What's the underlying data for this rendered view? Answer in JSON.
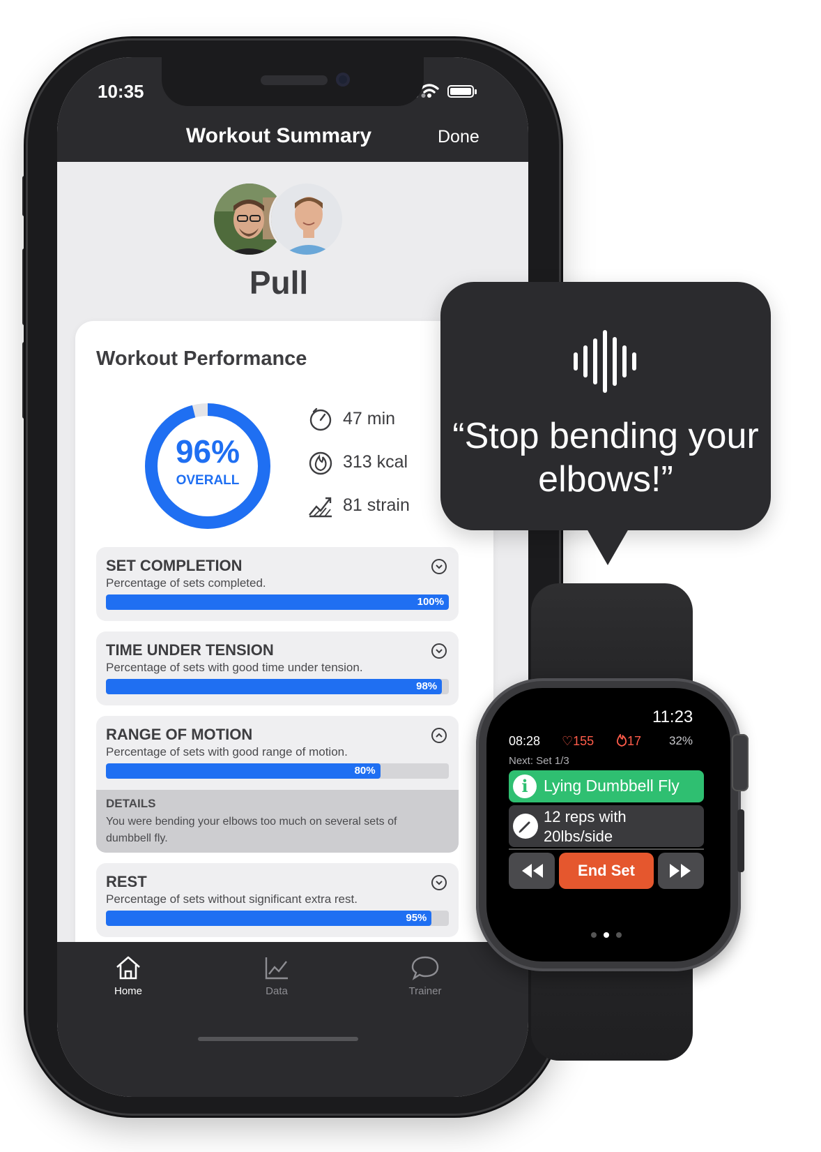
{
  "phone": {
    "status": {
      "time": "10:35"
    },
    "header": {
      "title": "Workout Summary",
      "done_label": "Done"
    },
    "workout_name": "Pull",
    "performance": {
      "title": "Workout Performance",
      "overall_percent_text": "96%",
      "overall_label": "OVERALL",
      "overall_fraction": 0.96,
      "ring_color": "#1f6ff2",
      "stats": [
        {
          "icon": "timer-icon",
          "value": "47 min"
        },
        {
          "icon": "flame-icon",
          "value": "313 kcal"
        },
        {
          "icon": "strain-chart-icon",
          "value": "81 strain"
        }
      ]
    },
    "metrics": [
      {
        "title": "SET COMPLETION",
        "description": "Percentage of sets completed.",
        "percent": 100,
        "percent_label": "100%",
        "expanded": false
      },
      {
        "title": "TIME UNDER TENSION",
        "description": "Percentage of sets with good time under tension.",
        "percent": 98,
        "percent_label": "98%",
        "expanded": false
      },
      {
        "title": "RANGE OF MOTION",
        "description": "Percentage of sets with good range of motion.",
        "percent": 80,
        "percent_label": "80%",
        "expanded": true,
        "details_title": "DETAILS",
        "details_text": "You were bending your elbows too much on several sets of dumbbell fly."
      },
      {
        "title": "REST",
        "description": "Percentage of sets without significant extra rest.",
        "percent": 95,
        "percent_label": "95%",
        "expanded": false
      }
    ],
    "tabs": [
      {
        "label": "Home",
        "icon": "home-icon",
        "active": true
      },
      {
        "label": "Data",
        "icon": "chart-icon",
        "active": false
      },
      {
        "label": "Trainer",
        "icon": "chat-bubble-icon",
        "active": false
      }
    ]
  },
  "bubble": {
    "icon": "voice-waveform-icon",
    "quote": "“Stop bending your elbows!”"
  },
  "watch": {
    "time": "11:23",
    "elapsed": "08:28",
    "heart_rate": "♡155",
    "calories": "17",
    "battery": "32%",
    "next_label": "Next: Set 1/3",
    "exercise": "Lying Dumbbell Fly",
    "reps": "12 reps with 20lbs/side",
    "end_set_label": "End Set",
    "accent_green": "#2fbf71",
    "accent_orange": "#e5572e"
  }
}
